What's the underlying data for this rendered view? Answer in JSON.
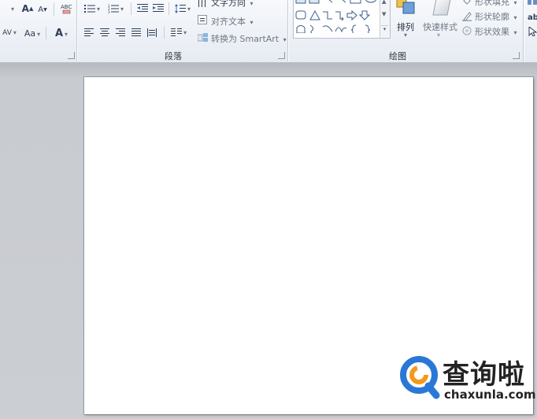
{
  "ribbon": {
    "groups": {
      "paragraph_label": "段落",
      "drawing_label": "绘图"
    },
    "paragraph": {
      "text_direction": "文字方向",
      "align_text": "对齐文本",
      "convert_smartart": "转换为 SmartArt"
    },
    "drawing": {
      "arrange": "排列",
      "quick_styles": "快速样式",
      "shape_fill": "形状填充",
      "shape_outline": "形状轮廓",
      "shape_effects": "形状效果"
    },
    "font": {
      "change_case": "Aa",
      "font_color_glyph": "A",
      "grow_font": "A",
      "shrink_font": "A",
      "char_spacing": "AV"
    }
  },
  "watermark": {
    "title": "查询啦",
    "url": "chaxunla.com",
    "brand_color": "#2a78d6",
    "accent_color": "#f29a1a"
  }
}
